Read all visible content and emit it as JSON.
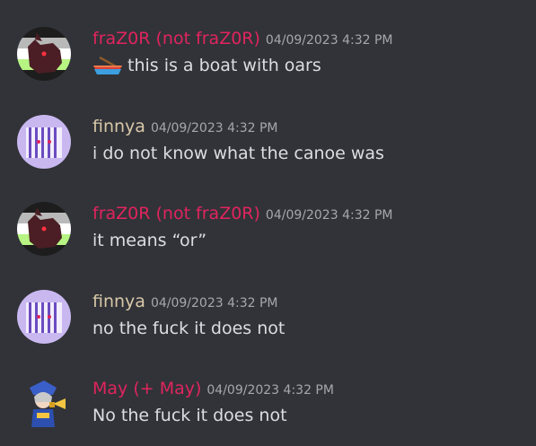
{
  "colors": {
    "background": "#313338",
    "text": "#dbdee1",
    "timestamp": "#a4a8ae",
    "frazor_name": "#e0245e",
    "finnya_name": "#d8c8a8",
    "may_name": "#e0245e"
  },
  "messages": [
    {
      "username": "fraZ0R (not fraZ0R)",
      "timestamp": "04/09/2023 4:32 PM",
      "emoji": "canoe-icon",
      "text": "this is a boat with oars"
    },
    {
      "username": "finnya",
      "timestamp": "04/09/2023 4:32 PM",
      "text": "i do not know what the canoe was"
    },
    {
      "username": "fraZ0R (not fraZ0R)",
      "timestamp": "04/09/2023 4:32 PM",
      "text": "it means “or”"
    },
    {
      "username": "finnya",
      "timestamp": "04/09/2023 4:32 PM",
      "text": "no the fuck it does not"
    },
    {
      "username": "May (+ May)",
      "timestamp": "04/09/2023 4:32 PM",
      "text": "No the fuck it does not"
    }
  ]
}
